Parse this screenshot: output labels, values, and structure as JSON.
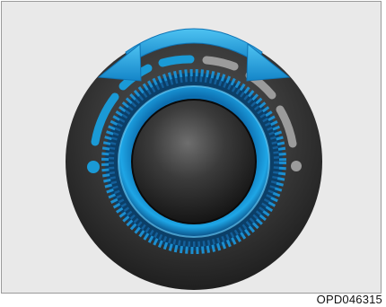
{
  "figure": {
    "code": "OPD046315",
    "subject": "rotary-knob",
    "icons": [
      "bidirectional-rotation-arrow-icon",
      "position-dot-left-icon",
      "position-dot-right-icon"
    ],
    "colors": {
      "background": "#e9e9e9",
      "accent_blue": "#1a9ad6",
      "indicator_gray": "#9b9b9b",
      "knob_dark": "#2b2b2b"
    }
  }
}
